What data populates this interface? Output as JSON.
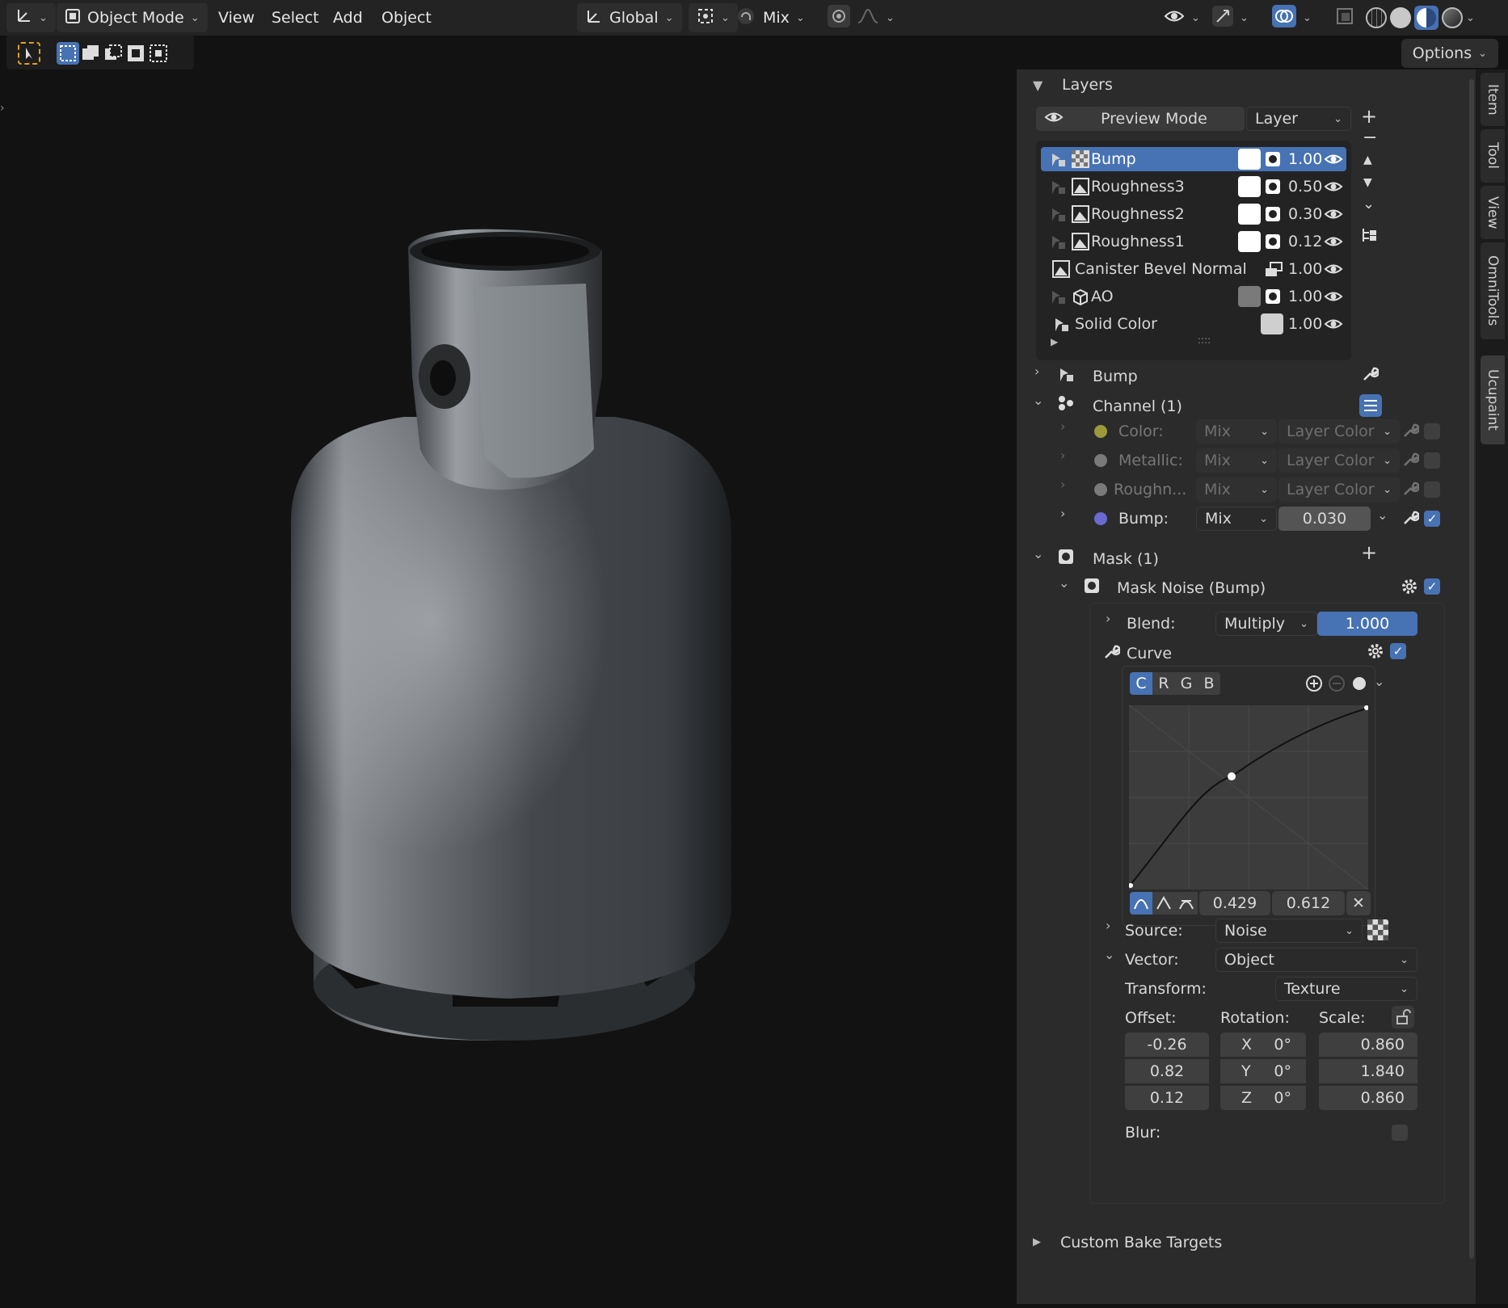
{
  "header": {
    "mode": "Object Mode",
    "menus": [
      "View",
      "Select",
      "Add",
      "Object"
    ],
    "orientation": "Global",
    "snap_mode": "Mix",
    "options_label": "Options"
  },
  "sidebar_tabs": [
    "Item",
    "Tool",
    "View",
    "OmniTools",
    "Ucupaint"
  ],
  "panel": {
    "layers_title": "Layers",
    "preview_mode": "Preview Mode",
    "preview_target": "Layer",
    "layers": [
      {
        "name": "Bump",
        "opacity": "1.00",
        "swatch": "#ffffff"
      },
      {
        "name": "Roughness3",
        "opacity": "0.50",
        "swatch": "#ffffff"
      },
      {
        "name": "Roughness2",
        "opacity": "0.30",
        "swatch": "#ffffff"
      },
      {
        "name": "Roughness1",
        "opacity": "0.12",
        "swatch": "#ffffff"
      },
      {
        "name": "Canister Bevel Normal",
        "opacity": "1.00",
        "swatch": ""
      },
      {
        "name": "AO",
        "opacity": "1.00",
        "swatch": "#7a7a7a"
      },
      {
        "name": "Solid Color",
        "opacity": "1.00",
        "swatch": "#cfcfcf"
      }
    ],
    "list_handle": "::::",
    "bump_section": "Bump",
    "channel_section": "Channel (1)",
    "channels": [
      {
        "name": "Color:",
        "blend": "Mix",
        "value": "Layer Color",
        "dot": "#9a9a3a"
      },
      {
        "name": "Metallic:",
        "blend": "Mix",
        "value": "Layer Color",
        "dot": "#7a7a7a"
      },
      {
        "name": "Roughn...",
        "blend": "Mix",
        "value": "Layer Color",
        "dot": "#7a7a7a"
      },
      {
        "name": "Bump:",
        "blend": "Mix",
        "value": "0.030",
        "dot": "#6a6ad0"
      }
    ],
    "mask_section": "Mask (1)",
    "mask_name": "Mask Noise (Bump)",
    "blend_label": "Blend:",
    "blend_mode": "Multiply",
    "blend_value": "1.000",
    "curve_label": "Curve",
    "curve_tabs": [
      "C",
      "R",
      "G",
      "B"
    ],
    "curve_point": {
      "x": "0.429",
      "y": "0.612"
    },
    "source_label": "Source:",
    "source_value": "Noise",
    "vector_label": "Vector:",
    "vector_value": "Object",
    "transform_label": "Transform:",
    "transform_value": "Texture",
    "offset_label": "Offset:",
    "rotation_label": "Rotation:",
    "scale_label": "Scale:",
    "offset": [
      "-0.26",
      "0.82",
      "0.12"
    ],
    "rotation_axes": [
      "X",
      "Y",
      "Z"
    ],
    "rotation": [
      "0°",
      "0°",
      "0°"
    ],
    "scale": [
      "0.860",
      "1.840",
      "0.860"
    ],
    "blur_label": "Blur:",
    "custom_bake": "Custom Bake Targets"
  },
  "colors": {
    "accent": "#4772b3",
    "panel_bg": "#2b2b2b",
    "viewport_bg": "#121212"
  }
}
